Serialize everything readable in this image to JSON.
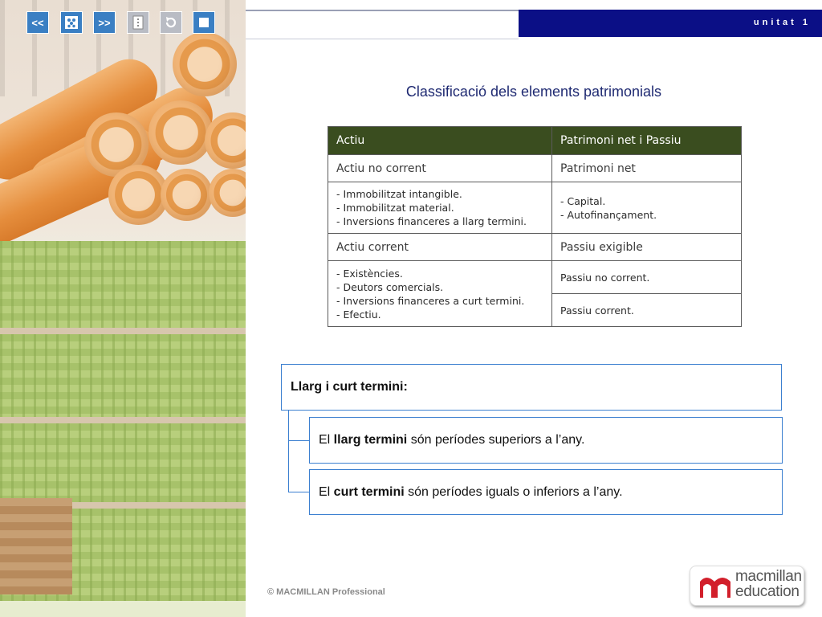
{
  "header": {
    "unit_label": "unitat 1",
    "nav_buttons": [
      {
        "name": "previous",
        "label": "<<"
      },
      {
        "name": "index",
        "label": ""
      },
      {
        "name": "next",
        "label": ">>"
      },
      {
        "name": "menu",
        "label": ""
      },
      {
        "name": "back",
        "label": ""
      },
      {
        "name": "stop",
        "label": ""
      }
    ]
  },
  "slide": {
    "title": "Classificació dels elements patrimonials"
  },
  "table": {
    "headers": [
      "Actiu",
      "Patrimoni net i Passiu"
    ],
    "rows": {
      "r1c1": "Actiu no corrent",
      "r1c2": "Patrimoni net",
      "r2c1": [
        "- Immobilitzat intangible.",
        "- Immobilitzat material.",
        "- Inversions financeres a llarg termini."
      ],
      "r2c2": [
        "- Capital.",
        "- Autofinançament."
      ],
      "r3c1": "Actiu corrent",
      "r3c2": "Passiu exigible",
      "r4c1": [
        "- Existències.",
        "- Deutors comercials.",
        "- Inversions financeres a curt termini.",
        "- Efectiu."
      ],
      "r4c2a": "Passiu no corrent.",
      "r4c2b": "Passiu corrent."
    }
  },
  "terms": {
    "heading": "Llarg i curt termini:",
    "long": {
      "prefix": "El ",
      "bold": "llarg termini",
      "suffix": " són períodes superiors a l’any."
    },
    "short": {
      "prefix": "El ",
      "bold": "curt termini",
      "suffix": " són períodes iguals o inferiors a l’any."
    }
  },
  "footer": {
    "copyright": "© MACMILLAN Professional",
    "logo_line1": "macmillan",
    "logo_line2": "education"
  },
  "colors": {
    "header_blue": "#0b0f86",
    "nav_blue": "#3a7fc3",
    "table_header": "#3a4d1f",
    "title": "#1f2a72",
    "box_border": "#3b7fd0",
    "logo_red": "#d21f2b"
  }
}
